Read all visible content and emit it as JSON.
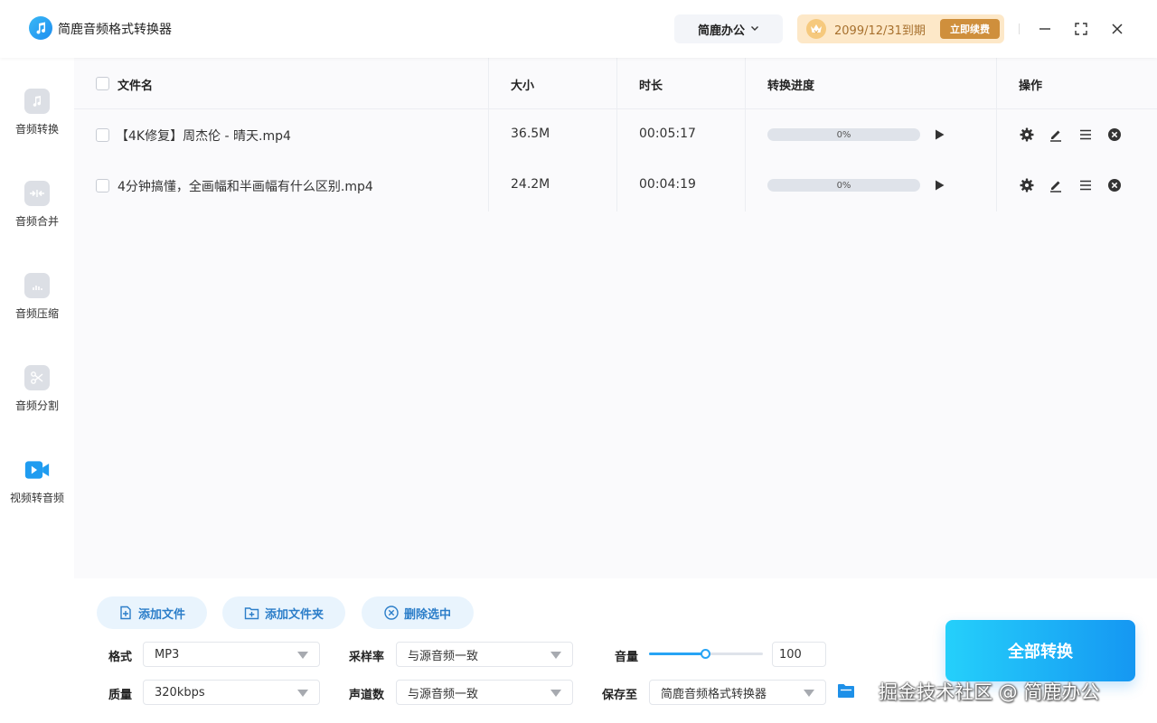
{
  "app": {
    "title": "简鹿音频格式转换器",
    "company_label": "简鹿办公",
    "vip_expiry": "2099/12/31到期",
    "renew_label": "立即续费"
  },
  "sidebar": {
    "items": [
      {
        "label": "音频转换",
        "icon": "music-note-icon",
        "active": false
      },
      {
        "label": "音频合并",
        "icon": "merge-icon",
        "active": false
      },
      {
        "label": "音频压缩",
        "icon": "compress-icon",
        "active": false
      },
      {
        "label": "音频分割",
        "icon": "scissors-icon",
        "active": false
      },
      {
        "label": "视频转音频",
        "icon": "video-camera-icon",
        "active": true
      }
    ]
  },
  "table": {
    "headers": {
      "filename": "文件名",
      "size": "大小",
      "duration": "时长",
      "progress": "转换进度",
      "actions": "操作"
    },
    "rows": [
      {
        "name": "【4K修复】周杰伦 - 晴天.mp4",
        "size": "36.5M",
        "duration": "00:05:17",
        "progress_text": "0%",
        "progress": 0
      },
      {
        "name": "4分钟搞懂，全画幅和半画幅有什么区别.mp4",
        "size": "24.2M",
        "duration": "00:04:19",
        "progress_text": "0%",
        "progress": 0
      }
    ]
  },
  "toolbar": {
    "add_file": "添加文件",
    "add_folder": "添加文件夹",
    "delete_selected": "删除选中"
  },
  "settings": {
    "format_label": "格式",
    "format_value": "MP3",
    "quality_label": "质量",
    "quality_value": "320kbps",
    "sample_rate_label": "采样率",
    "sample_rate_value": "与源音频一致",
    "channels_label": "声道数",
    "channels_value": "与源音频一致",
    "volume_label": "音量",
    "volume_value": "100",
    "volume_fraction": 0.5,
    "save_to_label": "保存至",
    "save_to_value": "简鹿音频格式转换器"
  },
  "convert_all_label": "全部转换",
  "watermark": "掘金技术社区 @ 简鹿办公",
  "colors": {
    "accent": "#27a4f5",
    "vip_bg": "#fde8c8",
    "vip_button": "#cf8f3c",
    "convert_gradient_start": "#25d0fb",
    "convert_gradient_end": "#1597f2"
  }
}
